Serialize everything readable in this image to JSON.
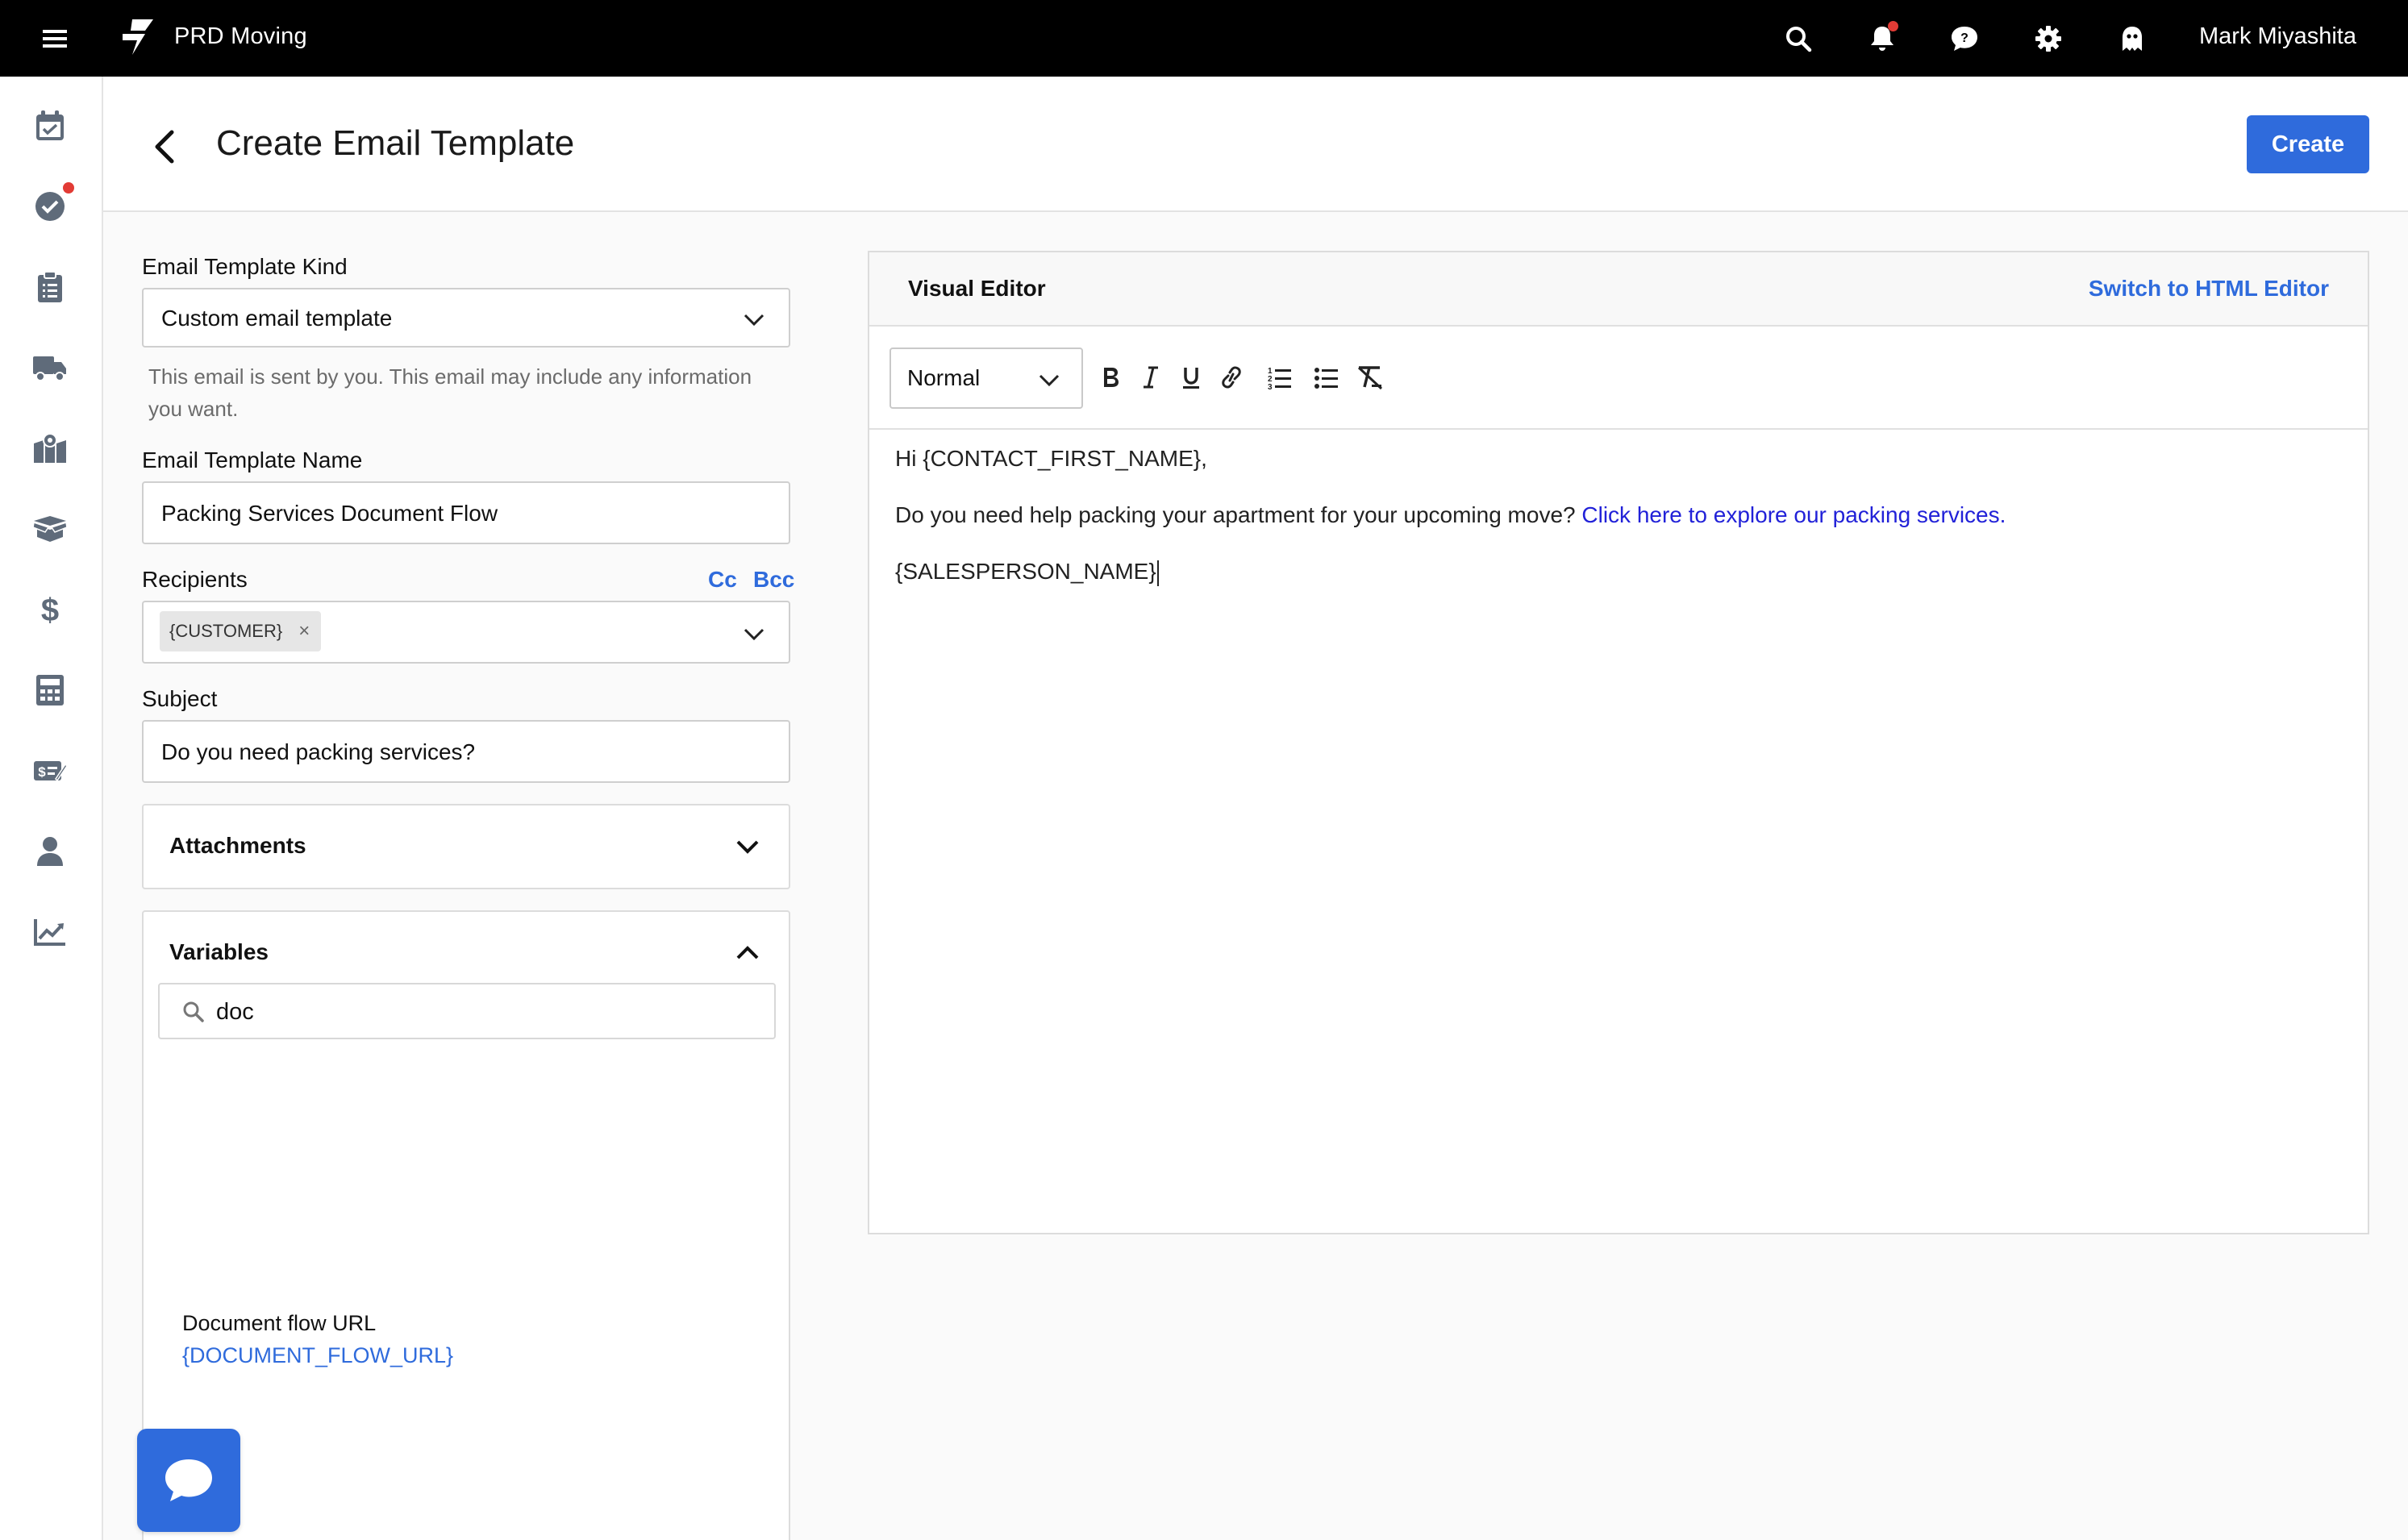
{
  "topbar": {
    "brand": "PRD Moving",
    "user_name": "Mark Miyashita",
    "icons": [
      "menu-icon",
      "search-icon",
      "bell-icon",
      "chat-icon",
      "gear-icon",
      "ghost-icon"
    ]
  },
  "sidebar": {
    "items": [
      {
        "icon": "calendar-check-icon"
      },
      {
        "icon": "check-circle-icon",
        "has_notification": true
      },
      {
        "icon": "clipboard-icon"
      },
      {
        "icon": "truck-icon"
      },
      {
        "icon": "map-icon"
      },
      {
        "icon": "box-open-icon"
      },
      {
        "icon": "dollar-icon"
      },
      {
        "icon": "calculator-icon"
      },
      {
        "icon": "ticket-icon"
      },
      {
        "icon": "user-icon"
      },
      {
        "icon": "chart-line-icon"
      }
    ]
  },
  "header": {
    "title": "Create Email Template",
    "create_label": "Create"
  },
  "form": {
    "kind_label": "Email Template Kind",
    "kind_value": "Custom email template",
    "kind_help": "This email is sent by you. This email may include any information you want.",
    "name_label": "Email Template Name",
    "name_value": "Packing Services Document Flow",
    "recipients_label": "Recipients",
    "cc_label": "Cc",
    "bcc_label": "Bcc",
    "recipient_chip": "{CUSTOMER}",
    "chip_remove": "×",
    "subject_label": "Subject",
    "subject_value": "Do you need packing services?",
    "attachments_label": "Attachments",
    "variables_label": "Variables",
    "variables_search": "doc",
    "variable_results": [
      {
        "name": "Document flow URL",
        "token": "{DOCUMENT_FLOW_URL}"
      }
    ]
  },
  "editor": {
    "title": "Visual Editor",
    "switch_label": "Switch to HTML Editor",
    "format_value": "Normal",
    "body": {
      "line1": "Hi {CONTACT_FIRST_NAME},",
      "line2_text": "Do you need help packing your apartment for your upcoming move? ",
      "line2_link": "Click here to explore our packing services.",
      "line3": "{SALESPERSON_NAME}"
    }
  },
  "colors": {
    "accent": "#2f6bdc",
    "topbar_bg": "#000000",
    "notification": "#e23b35",
    "editor_link": "#2121d8"
  }
}
